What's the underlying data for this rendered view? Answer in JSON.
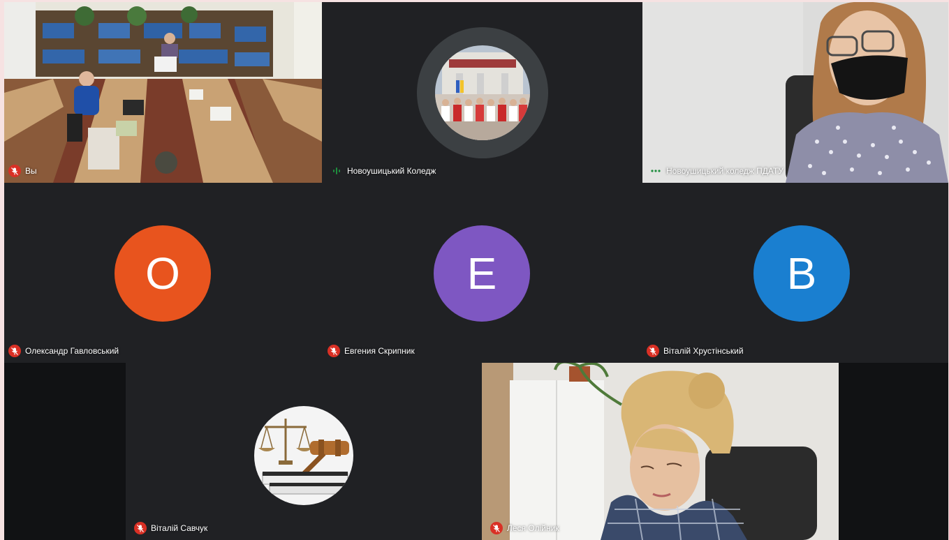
{
  "participants": [
    {
      "name": "Вы",
      "mic": "muted",
      "kind": "video",
      "scene": "library-meeting-room"
    },
    {
      "name": "Новоушицький Коледж",
      "mic": "speaking",
      "kind": "photo-avatar",
      "scene": "college-choir"
    },
    {
      "name": "Новоушицький коледж ПДАТУ",
      "mic": "active",
      "kind": "video",
      "scene": "woman-in-mask"
    },
    {
      "name": "Олександр Гавловський",
      "mic": "muted",
      "kind": "letter-avatar",
      "letter": "O",
      "color": "#e8541e"
    },
    {
      "name": "Евгения Скрипник",
      "mic": "muted",
      "kind": "letter-avatar",
      "letter": "E",
      "color": "#7e57c2"
    },
    {
      "name": "Віталій Хрустінський",
      "mic": "muted",
      "kind": "letter-avatar",
      "letter": "B",
      "color": "#1a7fd0"
    },
    {
      "name": "Віталій Савчук",
      "mic": "muted",
      "kind": "photo-avatar",
      "scene": "scales-and-gavel"
    },
    {
      "name": "Леся Олійник",
      "mic": "muted",
      "kind": "video",
      "scene": "woman-in-office"
    }
  ],
  "colors": {
    "background": "#202124",
    "tile": "#3c4043",
    "mute_red": "#d93025",
    "speaking_green": "#1e8e3e",
    "border": "#f6e2e2"
  }
}
